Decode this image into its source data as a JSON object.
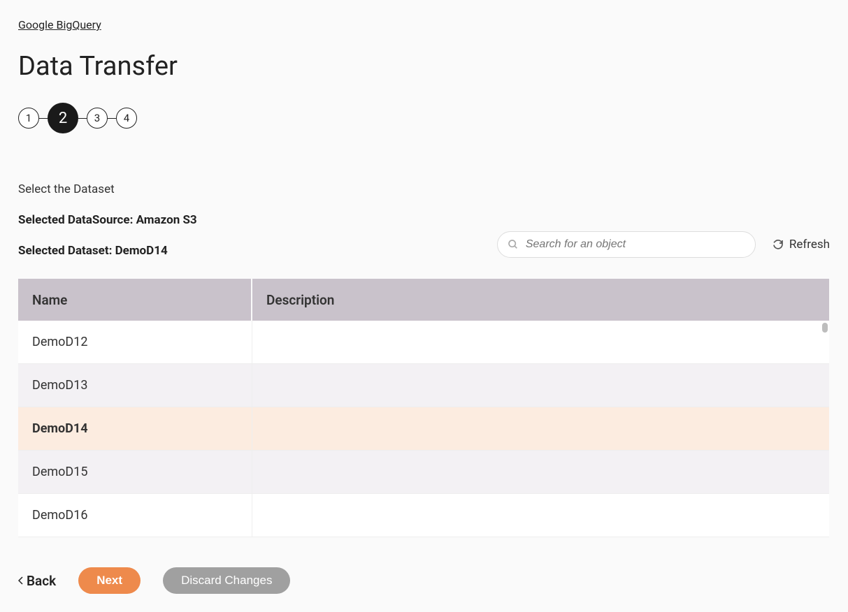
{
  "breadcrumb": "Google BigQuery",
  "title": "Data Transfer",
  "steps": [
    "1",
    "2",
    "3",
    "4"
  ],
  "active_step_index": 1,
  "instruction": "Select the Dataset",
  "selected_datasource_label": "Selected DataSource: Amazon S3",
  "selected_dataset_label": "Selected Dataset: DemoD14",
  "search": {
    "placeholder": "Search for an object"
  },
  "refresh_label": "Refresh",
  "columns": {
    "name": "Name",
    "description": "Description"
  },
  "rows": [
    {
      "name": "DemoD12",
      "description": "",
      "selected": false
    },
    {
      "name": "DemoD13",
      "description": "",
      "selected": false
    },
    {
      "name": "DemoD14",
      "description": "",
      "selected": true
    },
    {
      "name": "DemoD15",
      "description": "",
      "selected": false
    },
    {
      "name": "DemoD16",
      "description": "",
      "selected": false
    }
  ],
  "footer": {
    "back": "Back",
    "next": "Next",
    "discard": "Discard Changes"
  }
}
